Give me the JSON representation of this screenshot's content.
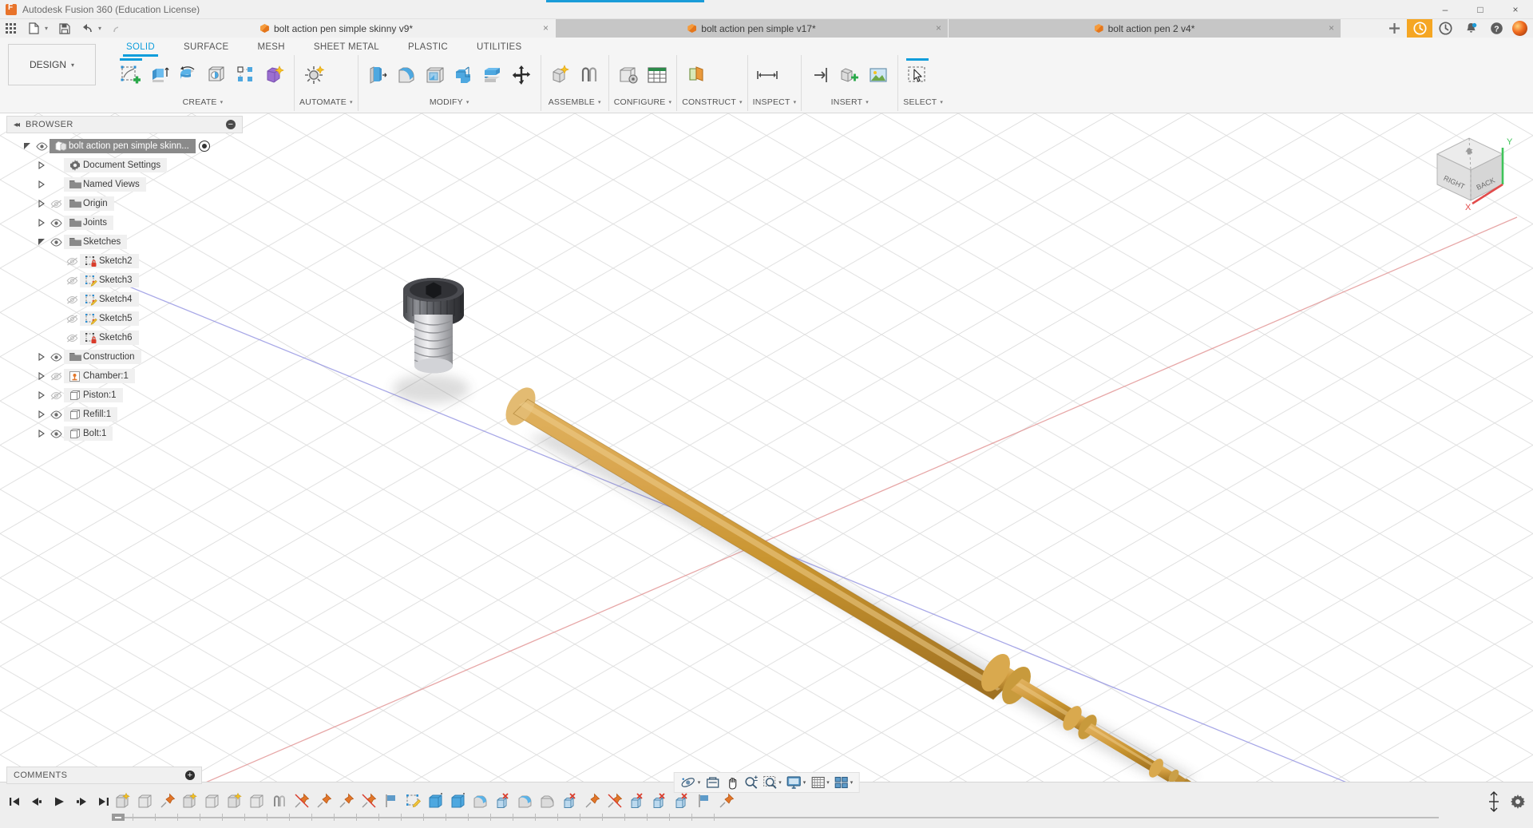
{
  "window": {
    "title": "Autodesk Fusion 360 (Education License)",
    "minimize": "–",
    "maximize": "□",
    "close": "×"
  },
  "quick_access": {
    "grid_icon": "grid-apps-icon",
    "new_icon": "new-file-icon",
    "save_icon": "save-icon",
    "undo_icon": "undo-icon",
    "redo_icon": "redo-icon",
    "home_icon": "home-icon",
    "caret": "▾"
  },
  "document_tabs": [
    {
      "label": "bolt action pen simple skinny v9*",
      "active": true,
      "close": "×"
    },
    {
      "label": "bolt action pen simple v17*",
      "active": false,
      "close": "×"
    },
    {
      "label": "bolt action pen 2 v4*",
      "active": false,
      "close": "×"
    }
  ],
  "top_right": {
    "add_label": "+",
    "items": [
      "add-tab-button",
      "job-status-icon",
      "recent-icon",
      "notifications-icon",
      "help-icon",
      "account-avatar"
    ]
  },
  "ribbon": {
    "design_label": "DESIGN",
    "design_caret": "▾",
    "tabs": [
      {
        "label": "SOLID",
        "active": true
      },
      {
        "label": "SURFACE",
        "active": false
      },
      {
        "label": "MESH",
        "active": false
      },
      {
        "label": "SHEET METAL",
        "active": false
      },
      {
        "label": "PLASTIC",
        "active": false
      },
      {
        "label": "UTILITIES",
        "active": false
      }
    ],
    "panels": [
      {
        "label": "CREATE",
        "caret": "▾"
      },
      {
        "label": "AUTOMATE",
        "caret": "▾"
      },
      {
        "label": "MODIFY",
        "caret": "▾"
      },
      {
        "label": "ASSEMBLE",
        "caret": "▾"
      },
      {
        "label": "CONFIGURE",
        "caret": "▾"
      },
      {
        "label": "CONSTRUCT",
        "caret": "▾"
      },
      {
        "label": "INSPECT",
        "caret": "▾"
      },
      {
        "label": "INSERT",
        "caret": "▾"
      },
      {
        "label": "SELECT",
        "caret": "▾"
      }
    ]
  },
  "browser": {
    "title": "BROWSER",
    "collapse_icon": "◂◂",
    "minus": "−",
    "items": [
      {
        "label": "bolt action pen simple skinn...",
        "indent": 0,
        "arrow": "down",
        "eye": "visible",
        "icon": "component-icon",
        "selected": true,
        "radio": true
      },
      {
        "label": "Document Settings",
        "indent": 1,
        "arrow": "right",
        "eye": "none",
        "icon": "gear-icon"
      },
      {
        "label": "Named Views",
        "indent": 1,
        "arrow": "right",
        "eye": "none",
        "icon": "folder-icon"
      },
      {
        "label": "Origin",
        "indent": 1,
        "arrow": "right",
        "eye": "hidden",
        "icon": "folder-icon"
      },
      {
        "label": "Joints",
        "indent": 1,
        "arrow": "right",
        "eye": "visible",
        "icon": "folder-icon"
      },
      {
        "label": "Sketches",
        "indent": 1,
        "arrow": "down",
        "eye": "visible",
        "icon": "folder-icon"
      },
      {
        "label": "Sketch2",
        "indent": 2,
        "arrow": "none",
        "eye": "hidden",
        "icon": "sketch-locked-icon"
      },
      {
        "label": "Sketch3",
        "indent": 2,
        "arrow": "none",
        "eye": "hidden",
        "icon": "sketch-edit-icon"
      },
      {
        "label": "Sketch4",
        "indent": 2,
        "arrow": "none",
        "eye": "hidden",
        "icon": "sketch-edit-icon"
      },
      {
        "label": "Sketch5",
        "indent": 2,
        "arrow": "none",
        "eye": "hidden",
        "icon": "sketch-edit-icon"
      },
      {
        "label": "Sketch6",
        "indent": 2,
        "arrow": "none",
        "eye": "hidden",
        "icon": "sketch-locked-icon"
      },
      {
        "label": "Construction",
        "indent": 1,
        "arrow": "right",
        "eye": "visible",
        "icon": "folder-icon"
      },
      {
        "label": "Chamber:1",
        "indent": 1,
        "arrow": "right",
        "eye": "hidden",
        "icon": "component-grounded-icon"
      },
      {
        "label": "Piston:1",
        "indent": 1,
        "arrow": "right",
        "eye": "hidden",
        "icon": "body-icon"
      },
      {
        "label": "Refill:1",
        "indent": 1,
        "arrow": "right",
        "eye": "visible",
        "icon": "body-icon"
      },
      {
        "label": "Bolt:1",
        "indent": 1,
        "arrow": "right",
        "eye": "visible",
        "icon": "body-icon"
      }
    ]
  },
  "viewcube": {
    "face_right": "RIGHT",
    "face_back": "BACK",
    "axis_x": "X",
    "axis_y": "Y",
    "home_icon": "home-icon"
  },
  "navbar": {
    "items": [
      {
        "name": "orbit-tool",
        "caret": "▾"
      },
      {
        "name": "look-at-tool",
        "caret": ""
      },
      {
        "name": "pan-tool",
        "caret": ""
      },
      {
        "name": "zoom-tool",
        "caret": ""
      },
      {
        "name": "zoom-window-tool",
        "caret": "▾"
      },
      {
        "name": "display-settings-tool",
        "caret": "▾"
      },
      {
        "name": "grid-snaps-tool",
        "caret": "▾"
      },
      {
        "name": "viewports-tool",
        "caret": "▾"
      }
    ]
  },
  "comments": {
    "title": "COMMENTS",
    "add": "+"
  },
  "timeline": {
    "playback": [
      "go-to-beginning",
      "step-back",
      "play",
      "step-forward",
      "go-to-end"
    ],
    "features": [
      "sketch-feature",
      "extrude-feature",
      "joint-origin-feature",
      "sketch-feature",
      "extrude-feature",
      "sketch-feature",
      "extrude-feature",
      "joint-feature",
      "rigid-group-feature",
      "joint-origin-feature",
      "joint-origin-feature",
      "flag-feature",
      "sketch-edit-feature",
      "extrude-feature",
      "extrude-feature",
      "revolve-feature",
      "delete-body-feature",
      "revolve-feature",
      "fillet-feature",
      "delete-body-feature",
      "joint-origin-feature",
      "rigid-group-feature",
      "delete-body-feature",
      "delete-body-feature",
      "delete-body-feature",
      "flag-feature",
      "joint-origin-feature"
    ],
    "marker_position": 0,
    "settings_icon": "gear-icon"
  }
}
